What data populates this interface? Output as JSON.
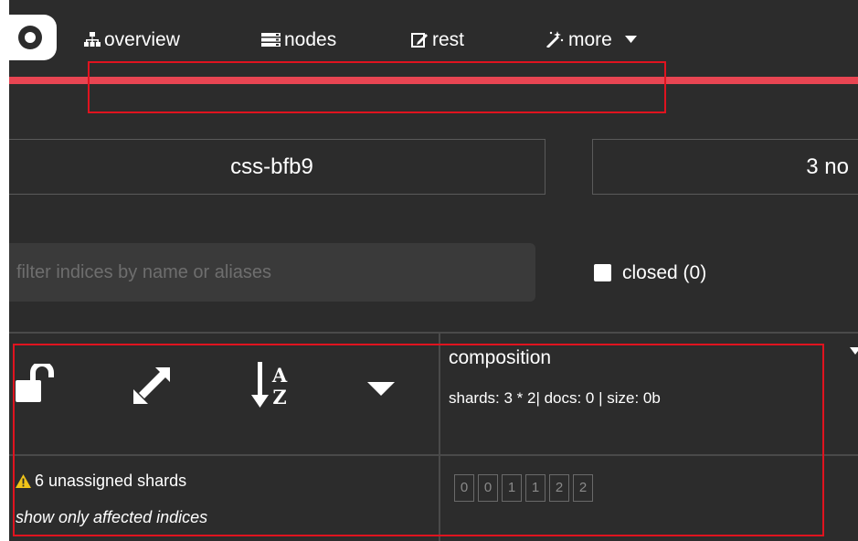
{
  "navbar": {
    "items": [
      {
        "label": "overview",
        "icon": "sitemap-icon"
      },
      {
        "label": "nodes",
        "icon": "server-icon"
      },
      {
        "label": "rest",
        "icon": "edit-icon"
      },
      {
        "label": "more",
        "icon": "magic-wand-icon"
      }
    ],
    "accent_color": "#e84552"
  },
  "cluster": {
    "name": "css-bfb9",
    "nodes_text": "3 no"
  },
  "filter": {
    "placeholder": "filter indices by name or aliases",
    "value": ""
  },
  "closed_toggle": {
    "label": "closed (0)",
    "checked": false
  },
  "index": {
    "name": "composition",
    "stats": "shards: 3 * 2| docs: 0 | size: 0b"
  },
  "unassigned": {
    "warning": "6 unassigned shards",
    "link": "show only affected indices"
  },
  "shards": [
    "0",
    "0",
    "1",
    "1",
    "2",
    "2"
  ],
  "colors": {
    "background": "#2c2c2c",
    "annotation_red": "#e0131f",
    "warning_yellow": "#f0c419"
  }
}
